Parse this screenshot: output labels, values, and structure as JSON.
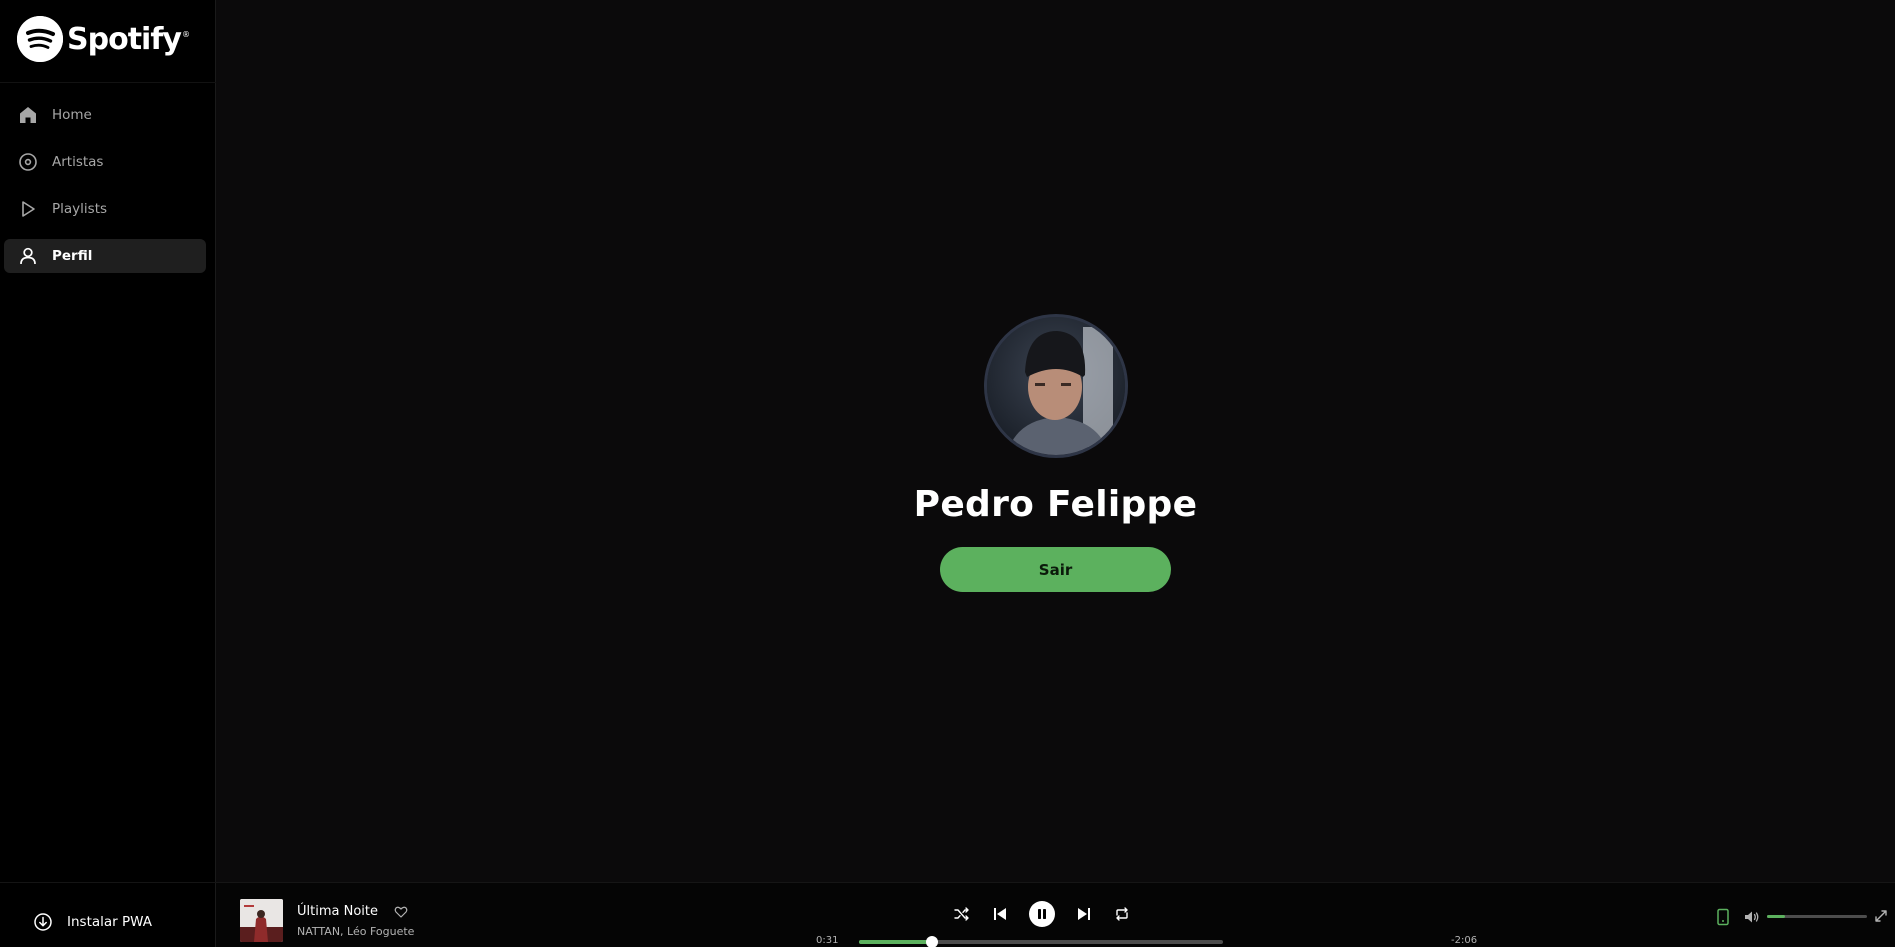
{
  "app": {
    "name": "Spotify",
    "accent_color": "#5cb15e"
  },
  "sidebar": {
    "logo_text": "Spotify",
    "items": [
      {
        "label": "Home",
        "icon": "home-icon",
        "active": false
      },
      {
        "label": "Artistas",
        "icon": "disc-icon",
        "active": false
      },
      {
        "label": "Playlists",
        "icon": "play-icon",
        "active": false
      },
      {
        "label": "Perfil",
        "icon": "user-icon",
        "active": true
      }
    ],
    "install_label": "Instalar PWA"
  },
  "profile": {
    "name": "Pedro Felippe",
    "logout_label": "Sair"
  },
  "player": {
    "track_title": "Última Noite",
    "track_artists": "NATTAN, Léo Foguete",
    "elapsed": "0:31",
    "remaining": "-2:06",
    "progress": 0.2,
    "volume": 0.18,
    "is_playing": true
  }
}
